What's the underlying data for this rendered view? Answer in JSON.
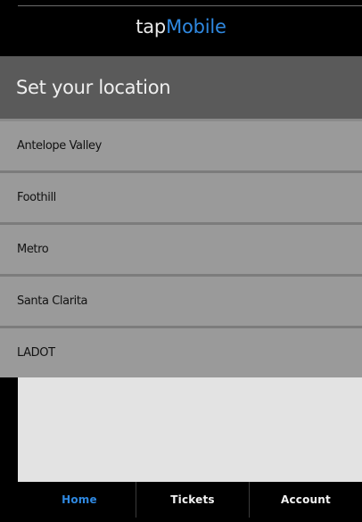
{
  "header": {
    "logo_tap": "tap",
    "logo_mobile": "Mobile"
  },
  "location": {
    "title": "Set your location",
    "items": [
      {
        "label": "Antelope Valley"
      },
      {
        "label": "Foothill"
      },
      {
        "label": "Metro"
      },
      {
        "label": "Santa Clarita"
      },
      {
        "label": "LADOT"
      }
    ]
  },
  "nav": {
    "tabs": [
      {
        "label": "Home",
        "active": true
      },
      {
        "label": "Tickets",
        "active": false
      },
      {
        "label": "Account",
        "active": false
      }
    ]
  },
  "colors": {
    "accent": "#2f88e0",
    "header_bg": "#000000",
    "title_bar_bg": "#5a5a5a",
    "list_item_bg": "#9a9a9a",
    "content_bg": "#e3e3e3"
  }
}
